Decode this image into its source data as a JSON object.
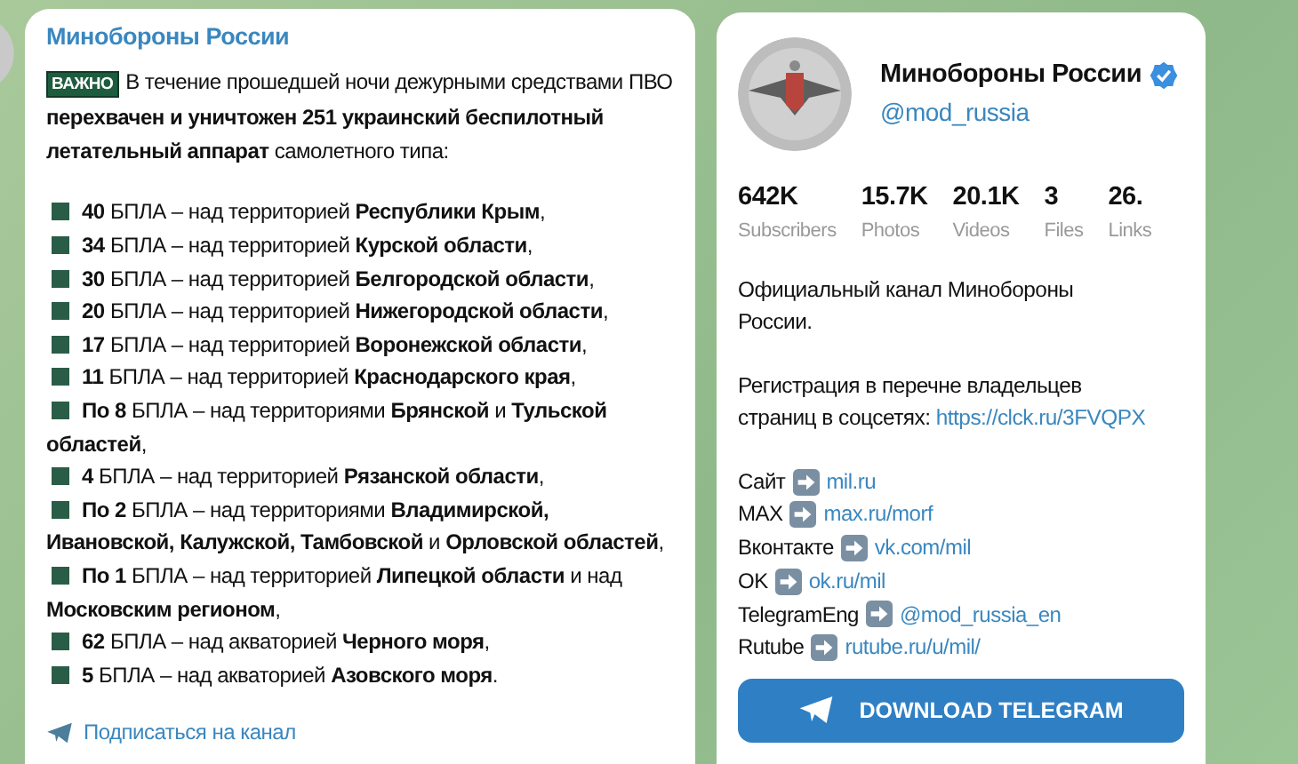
{
  "post": {
    "author": "Минобороны России",
    "badge": "ВАЖНО",
    "intro": "В течение прошедшей ночи дежурными средствами ПВО **перехвачен и уничтожен 251 украинский беспилотный летательный аппарат** самолетного типа:",
    "items": [
      "**40** БПЛА – над территорией **Республики Крым**,",
      "**34** БПЛА – над территорией **Курской области**,",
      "**30** БПЛА – над территорией **Белгородской области**,",
      "**20** БПЛА – над территорией **Нижегородской области**,",
      "**17** БПЛА – над территорией **Воронежской области**,",
      "**11** БПЛА – над территорией **Краснодарского края**,",
      "**По 8** БПЛА – над территориями **Брянской** и **Тульской областей**,",
      "**4** БПЛА – над территорией **Рязанской области**,",
      "**По 2** БПЛА – над территориями **Владимирской, Ивановской, Калужской, Тамбовской** и **Орловской областей**,",
      "**По 1** БПЛА – над территорией **Липецкой области** и над **Московским регионом**,",
      "**62** БПЛА – над акваторией **Черного моря**,",
      "**5** БПЛА – над акваторией **Азовского моря**."
    ],
    "subscribe_link": "Подписаться на канал"
  },
  "profile": {
    "name": "Минобороны России",
    "verified": true,
    "handle": "@mod_russia",
    "stats": [
      {
        "value": "642K",
        "label": "Subscribers"
      },
      {
        "value": "15.7K",
        "label": "Photos"
      },
      {
        "value": "20.1K",
        "label": "Videos"
      },
      {
        "value": "3",
        "label": "Files"
      },
      {
        "value": "26.",
        "label": "Links"
      }
    ],
    "description": "Официальный канал Минобороны России.",
    "registration_text": "Регистрация в перечне владельцев страниц в соцсетях:",
    "registration_link": "https://clck.ru/3FVQPX",
    "links": [
      {
        "label": "Сайт",
        "url": "mil.ru"
      },
      {
        "label": "MAX",
        "url": "max.ru/morf"
      },
      {
        "label": "Вконтакте",
        "url": "vk.com/mil"
      },
      {
        "label": "OK",
        "url": "ok.ru/mil"
      },
      {
        "label": "TelegramEng",
        "url": "@mod_russia_en"
      },
      {
        "label": "Rutube",
        "url": "rutube.ru/u/mil/"
      }
    ],
    "download_button": "DOWNLOAD TELEGRAM"
  }
}
